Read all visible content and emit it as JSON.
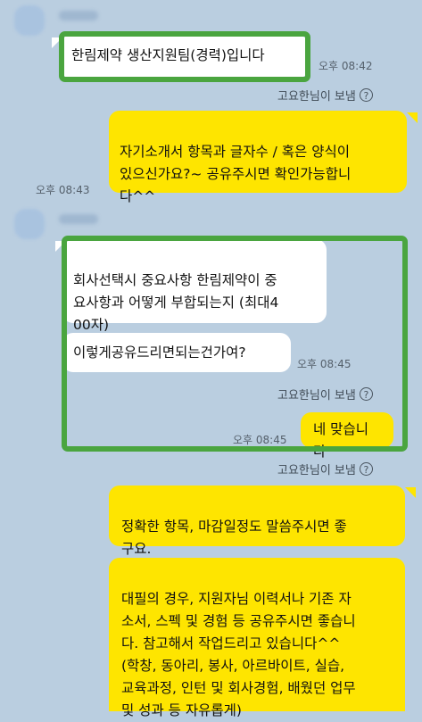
{
  "chat": {
    "msg1": {
      "text": "한림제약 생산지원팀(경력)입니다",
      "time": "오후 08:42"
    },
    "sender_line": "고요한님이 보냄",
    "msg2": {
      "text": "자기소개서 항목과 글자수 / 혹은 양식이\n있으신가요?~ 공유주시면 확인가능합니\n다^^",
      "time": "오후 08:43"
    },
    "msg3": {
      "text": "회사선택시 중요사항 한림제약이 중\n요사항과 어떻게 부합되는지 (최대4\n00자)"
    },
    "msg4": {
      "text": "이렇게공유드리면되는건가여?",
      "time": "오후 08:45"
    },
    "msg5": {
      "text": "네 맞습니다",
      "time": "오후 08:45"
    },
    "msg6": {
      "text": "정확한 항목, 마감일정도 말씀주시면 좋\n구요."
    },
    "msg7": {
      "text": "대필의 경우, 지원자님 이력서나 기존 자\n소서, 스펙 및 경험 등 공유주시면 좋습니\n다. 참고해서 작업드리고 있습니다^^\n(학창, 동아리, 봉사, 아르바이트, 실습,\n교육과정, 인턴 및 회사경험, 배웠던 업무\n및 성과 등 자유롭게)"
    }
  },
  "icons": {
    "help": "question-circle-icon"
  },
  "colors": {
    "background": "#bacee0",
    "my_bubble": "#fee500",
    "their_bubble": "#ffffff",
    "highlight": "#4aa53f"
  }
}
